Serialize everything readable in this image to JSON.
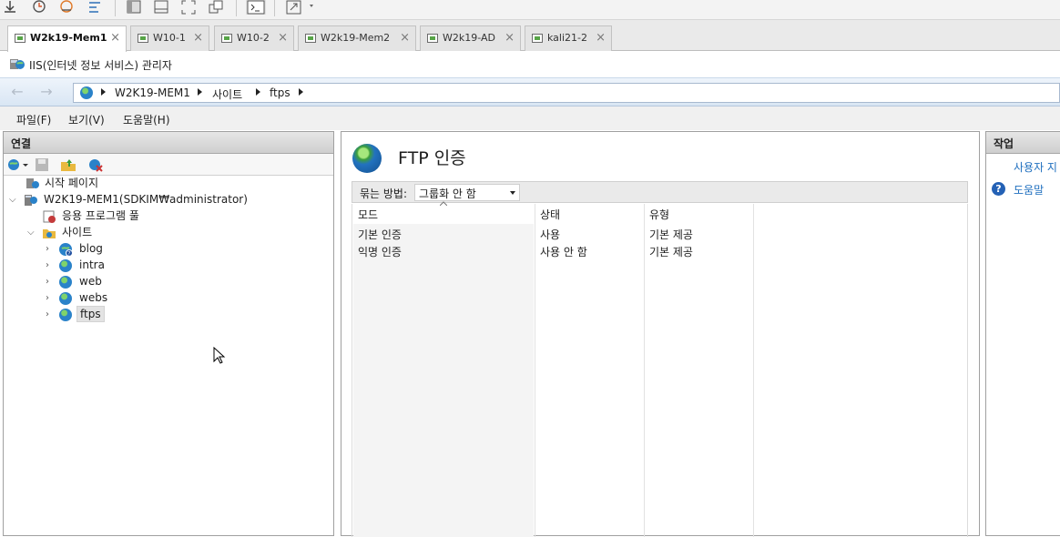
{
  "vm_tabs": [
    {
      "label": "W2k19-Mem1",
      "active": true
    },
    {
      "label": "W10-1",
      "active": false
    },
    {
      "label": "W10-2",
      "active": false
    },
    {
      "label": "W2k19-Mem2",
      "active": false
    },
    {
      "label": "W2k19-AD",
      "active": false
    },
    {
      "label": "kali21-2",
      "active": false
    }
  ],
  "tab_close_glyph": "×",
  "window": {
    "title": "IIS(인터넷 정보 서비스) 관리자"
  },
  "address": {
    "back": "←",
    "forward": "→",
    "crumbs": [
      "W2K19-MEM1",
      "사이트",
      "ftps"
    ]
  },
  "menu": {
    "file": "파일(F)",
    "view": "보기(V)",
    "help": "도움말(H)"
  },
  "connections": {
    "header": "연결",
    "tree": {
      "start_page": "시작 페이지",
      "server": "W2K19-MEM1(SDKIM₩administrator)",
      "app_pools": "응용 프로그램 풀",
      "sites": "사이트",
      "site_items": [
        "blog",
        "intra",
        "web",
        "webs",
        "ftps"
      ],
      "selected": "ftps"
    }
  },
  "main": {
    "title": "FTP 인증",
    "group_by_label": "묶는 방법:",
    "group_by_value": "그룹화 안 함",
    "columns": [
      "모드",
      "상태",
      "유형"
    ],
    "rows": [
      [
        "기본 인증",
        "사용",
        "기본 제공"
      ],
      [
        "익명 인증",
        "사용 안 함",
        "기본 제공"
      ]
    ]
  },
  "actions": {
    "header": "작업",
    "items": [
      "사용자 지",
      "도움말"
    ]
  },
  "colors": {
    "accent": "#1f6fbf",
    "panel_header": "#d6d6d6",
    "addr_bg": "#dfe9f5"
  },
  "icons": [
    "vm-icon",
    "globe-icon",
    "server-icon",
    "folder-icon",
    "help-icon",
    "cursor-icon"
  ]
}
